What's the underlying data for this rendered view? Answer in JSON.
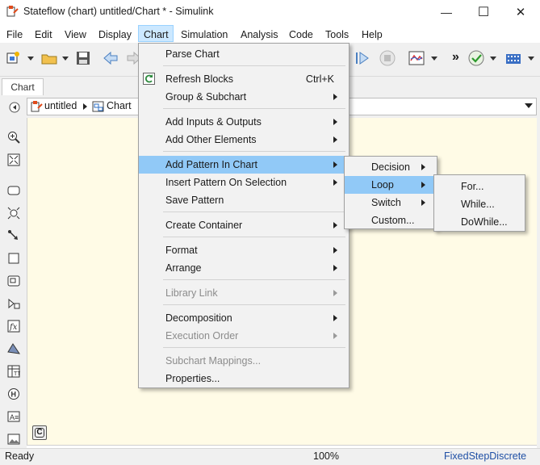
{
  "window": {
    "title": "Stateflow (chart) untitled/Chart * - Simulink",
    "min_glyph": "—",
    "max_glyph": "☐",
    "close_glyph": "✕"
  },
  "menubar": {
    "items": [
      "File",
      "Edit",
      "View",
      "Display",
      "Chart",
      "Simulation",
      "Analysis",
      "Code",
      "Tools",
      "Help"
    ],
    "active": "Chart"
  },
  "toolbar": {
    "overflow": "»"
  },
  "tabs": [
    "Chart"
  ],
  "breadcrumb": {
    "root": "untitled",
    "child": "Chart"
  },
  "chart_menu": {
    "items": [
      {
        "label": "Parse Chart"
      },
      {
        "label": "Refresh Blocks",
        "shortcut": "Ctrl+K",
        "icon": "refresh-icon"
      },
      {
        "label": "Group & Subchart",
        "submenu": true
      },
      {
        "label": "Add Inputs & Outputs",
        "submenu": true
      },
      {
        "label": "Add Other Elements",
        "submenu": true
      },
      {
        "label": "Add Pattern In Chart",
        "submenu": true,
        "highlighted": true
      },
      {
        "label": "Insert Pattern On Selection",
        "submenu": true
      },
      {
        "label": "Save Pattern"
      },
      {
        "label": "Create Container",
        "submenu": true
      },
      {
        "label": "Format",
        "submenu": true
      },
      {
        "label": "Arrange",
        "submenu": true
      },
      {
        "label": "Library Link",
        "submenu": true,
        "disabled": true
      },
      {
        "label": "Decomposition",
        "submenu": true
      },
      {
        "label": "Execution Order",
        "submenu": true,
        "disabled": true
      },
      {
        "label": "Subchart Mappings...",
        "disabled": true
      },
      {
        "label": "Properties..."
      }
    ]
  },
  "pattern_menu": {
    "items": [
      {
        "label": "Decision",
        "submenu": true
      },
      {
        "label": "Loop",
        "submenu": true,
        "highlighted": true
      },
      {
        "label": "Switch",
        "submenu": true
      },
      {
        "label": "Custom..."
      }
    ]
  },
  "loop_menu": {
    "items": [
      {
        "label": "For..."
      },
      {
        "label": "While..."
      },
      {
        "label": "DoWhile..."
      }
    ]
  },
  "canvas": {
    "chart_badge": "C"
  },
  "status": {
    "left": "Ready",
    "zoom": "100%",
    "solver": "FixedStepDiscrete"
  },
  "colors": {
    "canvas_bg": "#fffbe6",
    "menu_highlight": "#91c9f7",
    "menubar_active": "#cce8ff",
    "solver_link": "#1f4fa5"
  }
}
